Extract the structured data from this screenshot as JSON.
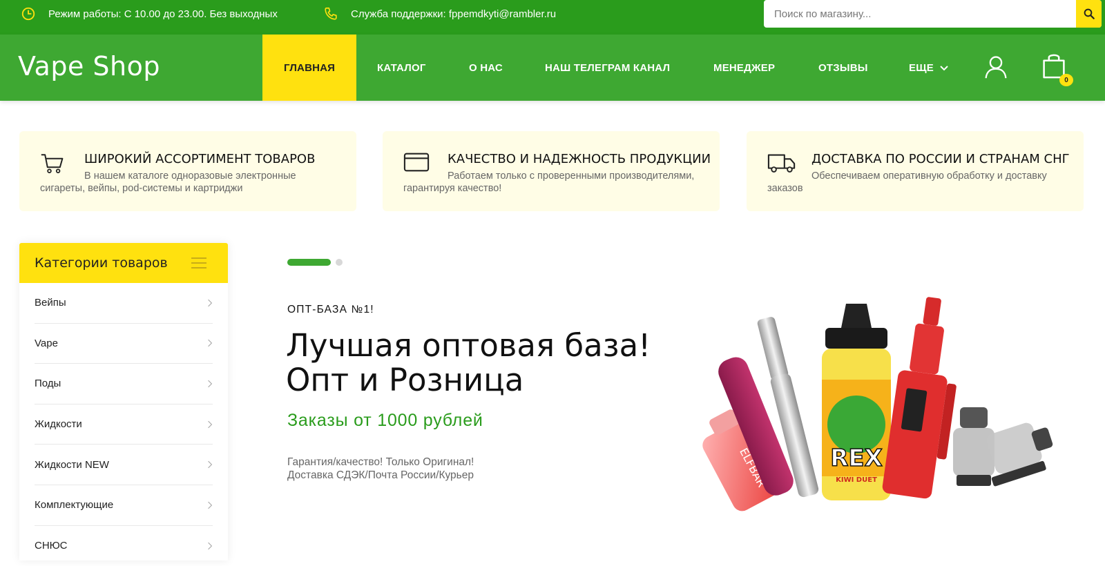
{
  "topbar": {
    "hours": "Режим работы: С 10.00 до 23.00. Без выходных",
    "support": "Служба поддержки: fppemdkyti@rambler.ru",
    "search_placeholder": "Поиск по магазину..."
  },
  "brand": {
    "logo_text": "Vape Shop"
  },
  "nav": {
    "items": [
      {
        "label": "Главная",
        "active": true
      },
      {
        "label": "Каталог"
      },
      {
        "label": "О нас"
      },
      {
        "label": "Наш телеграм канал"
      },
      {
        "label": "Менеджер"
      },
      {
        "label": "Отзывы"
      },
      {
        "label": "Еще"
      }
    ],
    "cart_count": "0"
  },
  "features": [
    {
      "title": "Широкий ассортимент товаров",
      "text": "В нашем каталоге одноразовые электронные сигареты, вейпы, pod-системы и картриджи",
      "icon": "cart-icon"
    },
    {
      "title": "Качество и надежность продукции",
      "text": "Работаем только с проверенными производителями, гарантируя качество!",
      "icon": "credit-card-icon"
    },
    {
      "title": "Доставка по России и странам СНГ",
      "text": "Обеспечиваем оперативную обработку и доставку заказов",
      "icon": "truck-icon"
    }
  ],
  "sidebar": {
    "title": "Категории товаров",
    "items": [
      {
        "label": "Вейпы"
      },
      {
        "label": "Vape"
      },
      {
        "label": "Поды"
      },
      {
        "label": "Жидкости"
      },
      {
        "label": "Жидкости NEW"
      },
      {
        "label": "Комплектующие"
      },
      {
        "label": "СНЮС"
      }
    ]
  },
  "hero": {
    "kicker": "ОПТ-БАЗА №1!",
    "title_line1": "Лучшая оптовая база!",
    "title_line2": "Опт и Розница",
    "subtitle": "Заказы от 1000 рублей",
    "desc_line1": "Гарантия/качество! Только Оригинал!",
    "desc_line2": "Доставка СДЭК/Почта России/Курьер",
    "bottle_label": "REX",
    "bottle_flavor": "KIWI DUET",
    "pod_brand": "ELFBAR"
  },
  "colors": {
    "topbar_green": "#2a9c1c",
    "nav_green": "#3ea832",
    "accent_yellow": "#ffe10f",
    "feature_bg": "#fffde6"
  }
}
